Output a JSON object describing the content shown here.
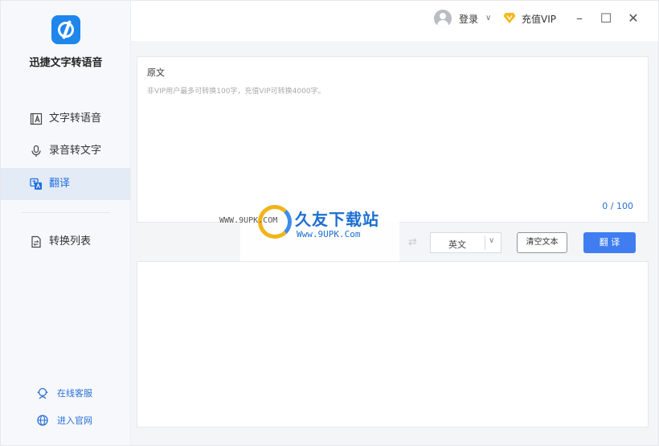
{
  "app": {
    "name": "迅捷文字转语音"
  },
  "sidebar": {
    "items": [
      {
        "label": "文字转语音",
        "icon": "text-to-speech-icon"
      },
      {
        "label": "录音转文字",
        "icon": "microphone-icon"
      },
      {
        "label": "翻译",
        "icon": "translate-icon",
        "active": true
      },
      {
        "label": "转换列表",
        "icon": "conversion-list-icon"
      }
    ],
    "footer": [
      {
        "label": "在线客服",
        "icon": "customer-service-icon"
      },
      {
        "label": "进入官网",
        "icon": "globe-icon"
      }
    ]
  },
  "titlebar": {
    "login_label": "登录",
    "vip_label": "充值VIP"
  },
  "source": {
    "title": "原文",
    "placeholder": "非VIP用户最多可转换100字，充值VIP可转换4000字。",
    "counter": "0 / 100"
  },
  "toolbar": {
    "target_language": "英文",
    "clear_label": "清空文本",
    "translate_label": "翻 译"
  },
  "watermark": {
    "left_text": "WWW.9UPK.COM",
    "title": "久友下载站",
    "url": "Www.9UPK.Com"
  },
  "colors": {
    "accent": "#3f7df1",
    "sidebar_active_bg": "#e3ebf7",
    "link": "#2a6fd6"
  }
}
